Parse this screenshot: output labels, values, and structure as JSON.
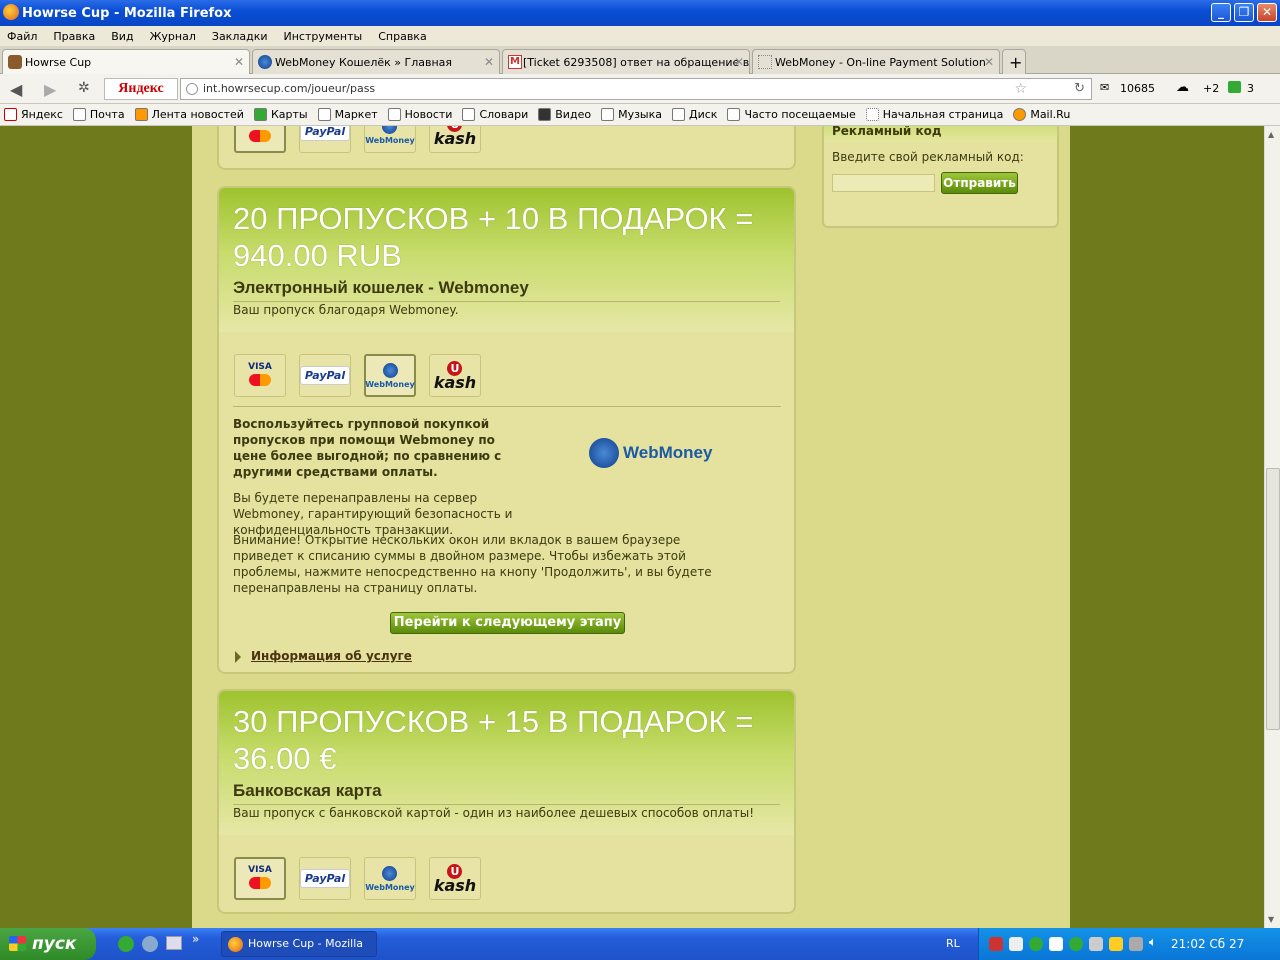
{
  "window": {
    "title": "Howrse Cup - Mozilla Firefox"
  },
  "menu": [
    "Файл",
    "Правка",
    "Вид",
    "Журнал",
    "Закладки",
    "Инструменты",
    "Справка"
  ],
  "tabs": [
    {
      "label": "Howrse Cup"
    },
    {
      "label": "WebMoney Кошелёк » Главная"
    },
    {
      "label": "[Ticket 6293508] ответ на обращение в..."
    },
    {
      "label": "WebMoney - On-line Payment Solution"
    }
  ],
  "nav": {
    "yandex": "Яндекс",
    "url": "int.howrsecup.com/joueur/pass",
    "mail_count": "10685",
    "weather": "+2",
    "count3": "3"
  },
  "bookmarks": [
    "Яндекс",
    "Почта",
    "Лента новостей",
    "Карты",
    "Маркет",
    "Новости",
    "Словари",
    "Видео",
    "Музыка",
    "Диск",
    "Часто посещаемые",
    "Начальная страница",
    "Mail.Ru"
  ],
  "pay_labels": {
    "paypal": "PayPal",
    "webmoney": "WebMoney",
    "ukash_u": "U",
    "ukash": "kash",
    "visa": "VISA"
  },
  "offer1": {
    "price": "20 ПРОПУСКОВ + 10 В ПОДАРОК = 940.00 RUB",
    "method": "Электронный кошелек - Webmoney",
    "desc": "Ваш пропуск благодаря Webmoney.",
    "bold_text": "Воспользуйтесь групповой покупкой пропусков при помощи Webmoney по цене более выгодной; по сравнению с другими средствами оплаты.",
    "logo": "WebMoney",
    "redirect": "Вы будете перенаправлены на сервер Webmoney, гарантирующий безопасность и конфиденциальность транзакции.",
    "warning": "Внимание! Открытие нескольких окон или вкладок в вашем браузере приведет к списанию суммы в двойном размере. Чтобы избежать этой проблемы, нажмите непосредственно на кнопу 'Продолжить', и вы будете перенаправлены на страницу оплаты.",
    "next_button": "Перейти к следующему этапу",
    "info_link": "Информация об услуге"
  },
  "offer2": {
    "price": "30 ПРОПУСКОВ + 15 В ПОДАРОК = 36.00 €",
    "method": "Банковская карта",
    "desc": "Ваш пропуск с банковской картой - один из наиболее дешевых способов оплаты!"
  },
  "promo": {
    "title": "Рекламный код",
    "label": "Введите свой рекламный код:",
    "input_value": "",
    "button": "Отправить"
  },
  "taskbar": {
    "start": "пуск",
    "task": "Howrse Cup - Mozilla ...",
    "lang": "RL",
    "clock": "21:02 Сб 27"
  }
}
